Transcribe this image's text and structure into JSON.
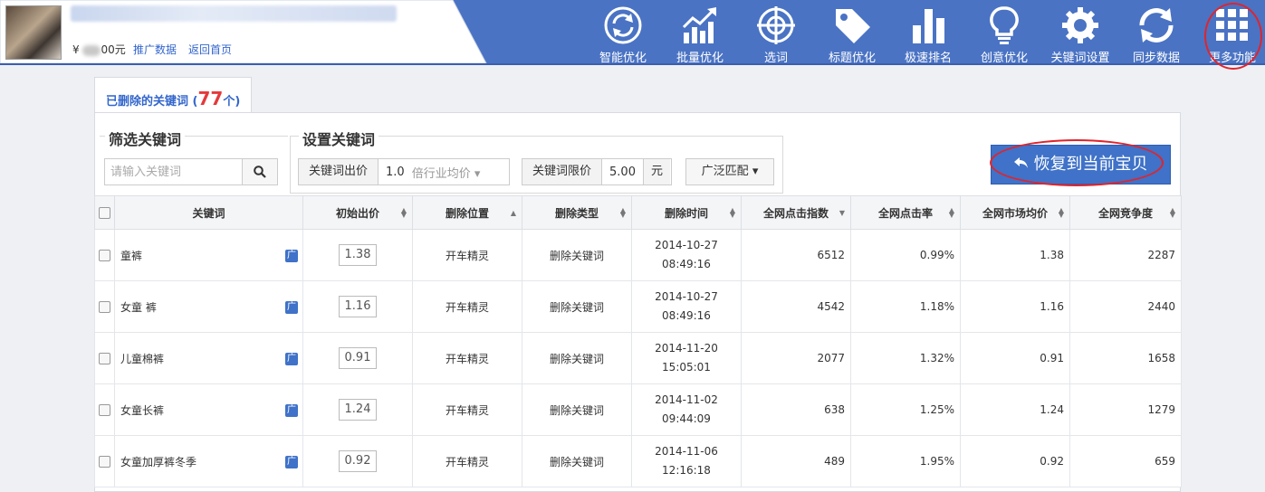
{
  "shop": {
    "balance_prefix": "¥",
    "balance_suffix": "00元",
    "links": [
      "推广数据",
      "返回首页"
    ]
  },
  "nav": [
    {
      "label": "智能优化",
      "icon": "refresh-circle-icon"
    },
    {
      "label": "批量优化",
      "icon": "bar-chart-up-icon"
    },
    {
      "label": "选词",
      "icon": "target-icon"
    },
    {
      "label": "标题优化",
      "icon": "tag-icon"
    },
    {
      "label": "极速排名",
      "icon": "bars-icon"
    },
    {
      "label": "创意优化",
      "icon": "lightbulb-icon"
    },
    {
      "label": "关键词设置",
      "icon": "gear-icon"
    },
    {
      "label": "同步数据",
      "icon": "sync-icon"
    },
    {
      "label": "更多功能",
      "icon": "grid-icon"
    }
  ],
  "tab": {
    "label": "已删除的关键词",
    "open": "(",
    "count": "77",
    "unit": "个)"
  },
  "filter": {
    "title": "筛选关键词",
    "placeholder": "请输入关键词"
  },
  "settings": {
    "title": "设置关键词",
    "bid_label": "关键词出价",
    "bid_value": "1.0",
    "bid_mode": "倍行业均价",
    "limit_label": "关键词限价",
    "limit_value": "5.00",
    "limit_unit": "元",
    "match_label": "广泛匹配"
  },
  "restore_button": "恢复到当前宝贝",
  "table": {
    "headers": [
      "关键词",
      "初始出价",
      "删除位置",
      "删除类型",
      "删除时间",
      "全网点击指数",
      "全网点击率",
      "全网市场均价",
      "全网竞争度"
    ],
    "badge": "广",
    "rows": [
      {
        "keyword": "童裤",
        "bid": "1.38",
        "location": "开车精灵",
        "type": "删除关键词",
        "date": "2014-10-27",
        "time": "08:49:16",
        "clicks": "6512",
        "ctr": "0.99%",
        "price": "1.38",
        "competition": "2287"
      },
      {
        "keyword": "女童 裤",
        "bid": "1.16",
        "location": "开车精灵",
        "type": "删除关键词",
        "date": "2014-10-27",
        "time": "08:49:16",
        "clicks": "4542",
        "ctr": "1.18%",
        "price": "1.16",
        "competition": "2440"
      },
      {
        "keyword": "儿童棉裤",
        "bid": "0.91",
        "location": "开车精灵",
        "type": "删除关键词",
        "date": "2014-11-20",
        "time": "15:05:01",
        "clicks": "2077",
        "ctr": "1.32%",
        "price": "0.91",
        "competition": "1658"
      },
      {
        "keyword": "女童长裤",
        "bid": "1.24",
        "location": "开车精灵",
        "type": "删除关键词",
        "date": "2014-11-02",
        "time": "09:44:09",
        "clicks": "638",
        "ctr": "1.25%",
        "price": "1.24",
        "competition": "1279"
      },
      {
        "keyword": "女童加厚裤冬季",
        "bid": "0.92",
        "location": "开车精灵",
        "type": "删除关键词",
        "date": "2014-11-06",
        "time": "12:16:18",
        "clicks": "489",
        "ctr": "1.95%",
        "price": "0.92",
        "competition": "659"
      }
    ]
  },
  "colors": {
    "header_blue": "#4a73c4",
    "accent_red": "#e4393c",
    "link_blue": "#3366cc",
    "highlight_ring": "#e0242c"
  }
}
